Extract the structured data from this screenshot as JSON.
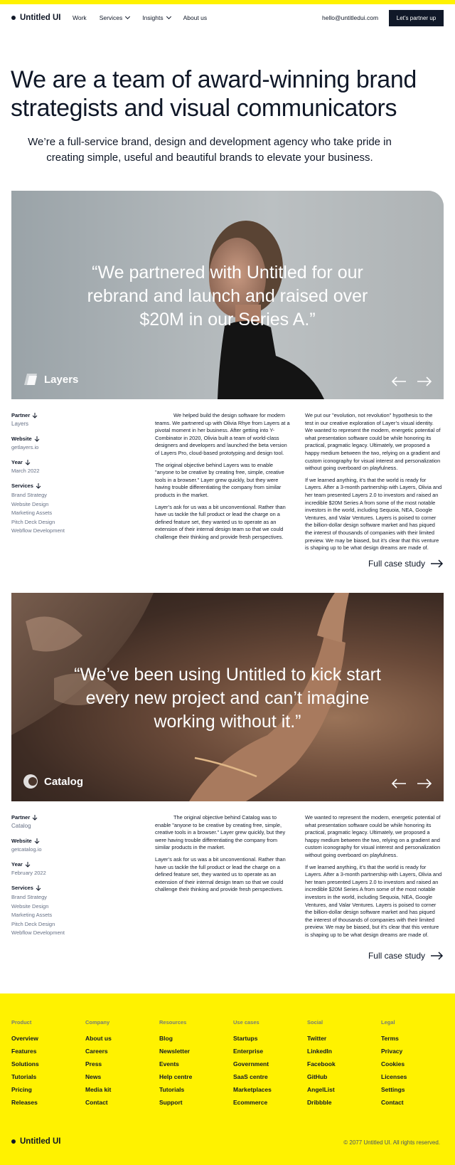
{
  "nav": {
    "logo": "Untitled UI",
    "links": [
      {
        "label": "Work"
      },
      {
        "label": "Services"
      },
      {
        "label": "Insights"
      },
      {
        "label": "About us"
      }
    ],
    "email": "hello@untitledui.com",
    "cta": "Let’s partner up"
  },
  "hero": {
    "title": "We are a team of award-winning brand strategists and visual communicators",
    "subtitle": "We’re a full-service brand, design and development agency who take pride in creating simple, useful and beautiful brands to elevate your business."
  },
  "cases": [
    {
      "quote": "“We partnered with Untitled for our rebrand and launch and raised over $20M in our Series A.”",
      "brand": "Layers",
      "partner_label": "Partner",
      "partner": "Layers",
      "website_label": "Website",
      "website": "getlayers.io",
      "year_label": "Year",
      "year": "March 2022",
      "services_label": "Services",
      "services": [
        "Brand Strategy",
        "Website Design",
        "Marketing Assets",
        "Pitch Deck Design",
        "Webflow Development"
      ],
      "col2": [
        "We helped build the design software for modern teams. We partnered up with Olivia Rhye from Layers at a pivotal moment in her business. After getting into Y-Combinator in 2020, Olivia built a team of world-class designers and developers and launched the beta version of Layers Pro, cloud-based prototyping and design tool.",
        "The original objective behind Layers was to enable \"anyone to be creative by creating free, simple, creative tools in a browser.\" Layer grew quickly, but they were having trouble differentiating the company from similar products in the market.",
        "Layer’s ask for us was a bit unconventional. Rather than have us tackle the full product or lead the charge on a defined feature set, they wanted us to operate as an extension of their internal design team so that we could challenge their thinking and provide fresh perspectives."
      ],
      "col3": [
        "We put our \"evolution, not revolution\" hypothesis to the test in our creative exploration of Layer’s visual identity. We wanted to represent the modern, energetic potential of what presentation software could be while honoring its practical, pragmatic legacy. Ultimately, we proposed a happy medium between the two, relying on a gradient and custom iconography for visual interest and personalization without going overboard on playfulness.",
        "If we learned anything, it’s that the world is ready for Layers. After a 3-month partnership with Layers, Olivia and her team presented Layers 2.0 to investors and raised an incredible $20M Series A from some of the most notable investors in the world, including Sequoia, NEA, Google Ventures, and Valar Ventures. Layers is poised to corner the billion-dollar design software market and has piqued the interest of thousands of companies with their limited preview. We may be biased, but it’s clear that this venture is shaping up to be what design dreams are made of."
      ],
      "full_case": "Full case study"
    },
    {
      "quote": "“We’ve been using Untitled to kick start every new project and can’t imagine working without it.”",
      "brand": "Catalog",
      "partner_label": "Partner",
      "partner": "Catalog",
      "website_label": "Website",
      "website": "getcatalog.io",
      "year_label": "Year",
      "year": "February 2022",
      "services_label": "Services",
      "services": [
        "Brand Strategy",
        "Website Design",
        "Marketing Assets",
        "Pitch Deck Design",
        "Webflow Development"
      ],
      "col2": [
        "The original objective behind Catalog was to enable \"anyone to be creative by creating free, simple, creative tools in a browser.\" Layer grew quickly, but they were having trouble differentiating the company from similar products in the market.",
        "Layer’s ask for us was a bit unconventional. Rather than have us tackle the full product or lead the charge on a defined feature set, they wanted us to operate as an extension of their internal design team so that we could challenge their thinking and provide fresh perspectives."
      ],
      "col3": [
        "We wanted to represent the modern, energetic potential of what presentation software could be while honoring its practical, pragmatic legacy. Ultimately, we proposed a happy medium between the two, relying on a gradient and custom iconography for visual interest and personalization without going overboard on playfulness.",
        "If we learned anything, it’s that the world is ready for Layers. After a 3-month partnership with Layers, Olivia and her team presented Layers 2.0 to investors and raised an incredible $20M Series A from some of the most notable investors in the world, including Sequoia, NEA, Google Ventures, and Valar Ventures. Layers is poised to corner the billion-dollar design software market and has piqued the interest of thousands of companies with their limited preview. We may be biased, but it’s clear that this venture is shaping up to be what design dreams are made of."
      ],
      "full_case": "Full case study"
    }
  ],
  "footer": {
    "columns": [
      {
        "head": "Product",
        "links": [
          "Overview",
          "Features",
          "Solutions",
          "Tutorials",
          "Pricing",
          "Releases"
        ]
      },
      {
        "head": "Company",
        "links": [
          "About us",
          "Careers",
          "Press",
          "News",
          "Media kit",
          "Contact"
        ]
      },
      {
        "head": "Resources",
        "links": [
          "Blog",
          "Newsletter",
          "Events",
          "Help centre",
          "Tutorials",
          "Support"
        ]
      },
      {
        "head": "Use cases",
        "links": [
          "Startups",
          "Enterprise",
          "Government",
          "SaaS centre",
          "Marketplaces",
          "Ecommerce"
        ]
      },
      {
        "head": "Social",
        "links": [
          "Twitter",
          "LinkedIn",
          "Facebook",
          "GitHub",
          "AngelList",
          "Dribbble"
        ]
      },
      {
        "head": "Legal",
        "links": [
          "Terms",
          "Privacy",
          "Cookies",
          "Licenses",
          "Settings",
          "Contact"
        ]
      }
    ],
    "logo": "Untitled UI",
    "copyright": "© 2077 Untitled UI. All rights reserved."
  },
  "colors": {
    "accent": "#fff200",
    "dark": "#101828",
    "muted": "#667085"
  }
}
